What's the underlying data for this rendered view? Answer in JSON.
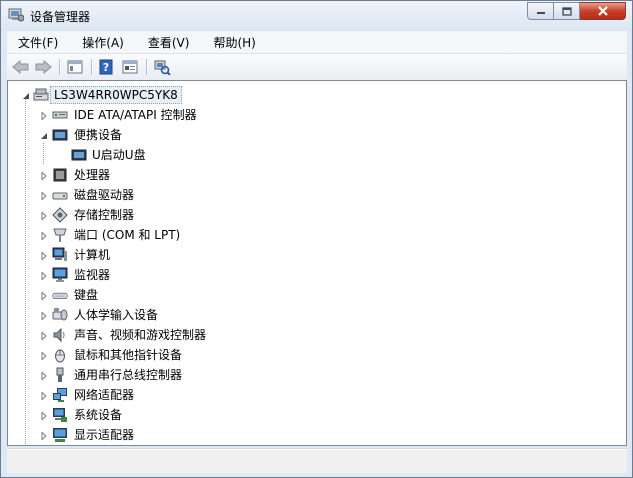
{
  "window": {
    "title": "设备管理器",
    "icon": "device-manager-icon"
  },
  "menu": [
    {
      "label": "文件(F)"
    },
    {
      "label": "操作(A)"
    },
    {
      "label": "查看(V)"
    },
    {
      "label": "帮助(H)"
    }
  ],
  "toolbar": {
    "buttons": [
      "back-arrow-icon",
      "forward-arrow-icon",
      "show-hide-tree-icon",
      "help-icon",
      "properties-icon",
      "scan-hardware-icon"
    ]
  },
  "tree": {
    "root": "LS3W4RR0WPC5YK8",
    "items": [
      {
        "label": "IDE ATA/ATAPI 控制器",
        "expanded": false,
        "icon": "ide-controller-icon"
      },
      {
        "label": "便携设备",
        "expanded": true,
        "icon": "portable-device-icon"
      },
      {
        "label": "U启动U盘",
        "child": true,
        "icon": "usb-drive-icon"
      },
      {
        "label": "处理器",
        "expanded": false,
        "icon": "processor-icon"
      },
      {
        "label": "磁盘驱动器",
        "expanded": false,
        "icon": "disk-drive-icon"
      },
      {
        "label": "存储控制器",
        "expanded": false,
        "icon": "storage-controller-icon"
      },
      {
        "label": "端口 (COM 和 LPT)",
        "expanded": false,
        "icon": "port-icon"
      },
      {
        "label": "计算机",
        "expanded": false,
        "icon": "computer-icon"
      },
      {
        "label": "监视器",
        "expanded": false,
        "icon": "monitor-icon"
      },
      {
        "label": "键盘",
        "expanded": false,
        "icon": "keyboard-icon"
      },
      {
        "label": "人体学输入设备",
        "expanded": false,
        "icon": "hid-icon"
      },
      {
        "label": "声音、视频和游戏控制器",
        "expanded": false,
        "icon": "sound-icon"
      },
      {
        "label": "鼠标和其他指针设备",
        "expanded": false,
        "icon": "mouse-icon"
      },
      {
        "label": "通用串行总线控制器",
        "expanded": false,
        "icon": "usb-controller-icon"
      },
      {
        "label": "网络适配器",
        "expanded": false,
        "icon": "network-adapter-icon"
      },
      {
        "label": "系统设备",
        "expanded": false,
        "icon": "system-device-icon"
      },
      {
        "label": "显示适配器",
        "expanded": false,
        "icon": "display-adapter-icon"
      }
    ]
  },
  "colors": {
    "titlebar": "#dbe6f3",
    "close_button": "#c7402b",
    "tree_background": "#ffffff"
  }
}
